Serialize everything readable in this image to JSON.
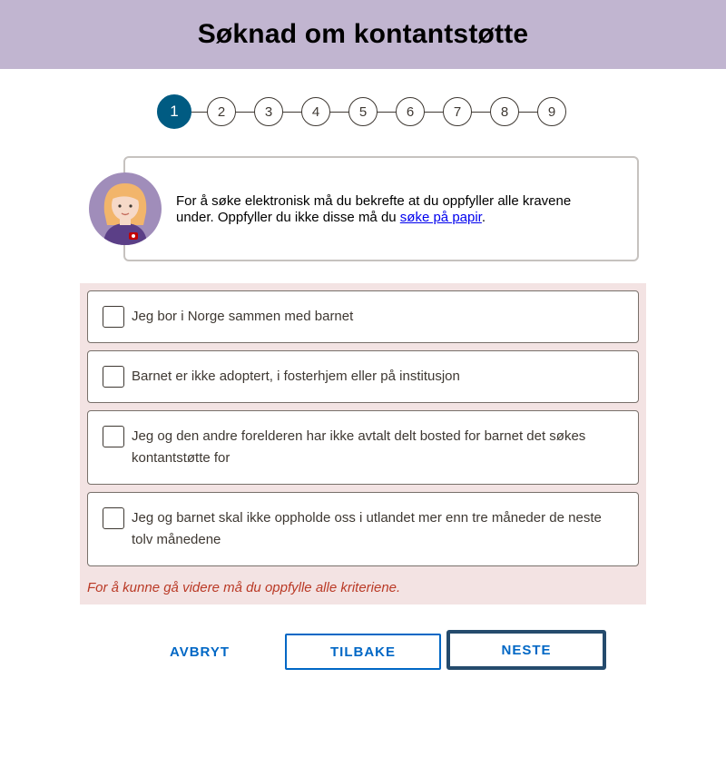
{
  "header": {
    "title": "Søknad om kontantstøtte"
  },
  "stepper": {
    "current": 1,
    "steps": [
      "1",
      "2",
      "3",
      "4",
      "5",
      "6",
      "7",
      "8",
      "9"
    ]
  },
  "intro": {
    "text": "For å søke elektronisk må du bekrefte at du oppfyller alle kravene under. Oppfyller du ikke disse må du ",
    "link_text": "søke på papir",
    "after_link": ".",
    "avatar_icon": "veileder-avatar-icon"
  },
  "criteria": {
    "items": [
      {
        "label": "Jeg bor i Norge sammen med barnet",
        "checked": false
      },
      {
        "label": "Barnet er ikke adoptert, i fosterhjem eller på institusjon",
        "checked": false
      },
      {
        "label": "Jeg og den andre forelderen har ikke avtalt delt bosted for barnet det søkes kontantstøtte for",
        "checked": false
      },
      {
        "label": "Jeg og barnet skal ikke oppholde oss i utlandet mer enn tre måneder de neste tolv månedene",
        "checked": false
      }
    ],
    "error": "For å kunne gå videre må du oppfylle alle kriteriene."
  },
  "actions": {
    "cancel": "AVBRYT",
    "back": "TILBAKE",
    "next": "NESTE"
  },
  "colors": {
    "header_bg": "#c1b5d0",
    "step_active": "#005b82",
    "criteria_bg": "#f3e3e3",
    "error": "#ba3a26",
    "button": "#0067c5"
  }
}
